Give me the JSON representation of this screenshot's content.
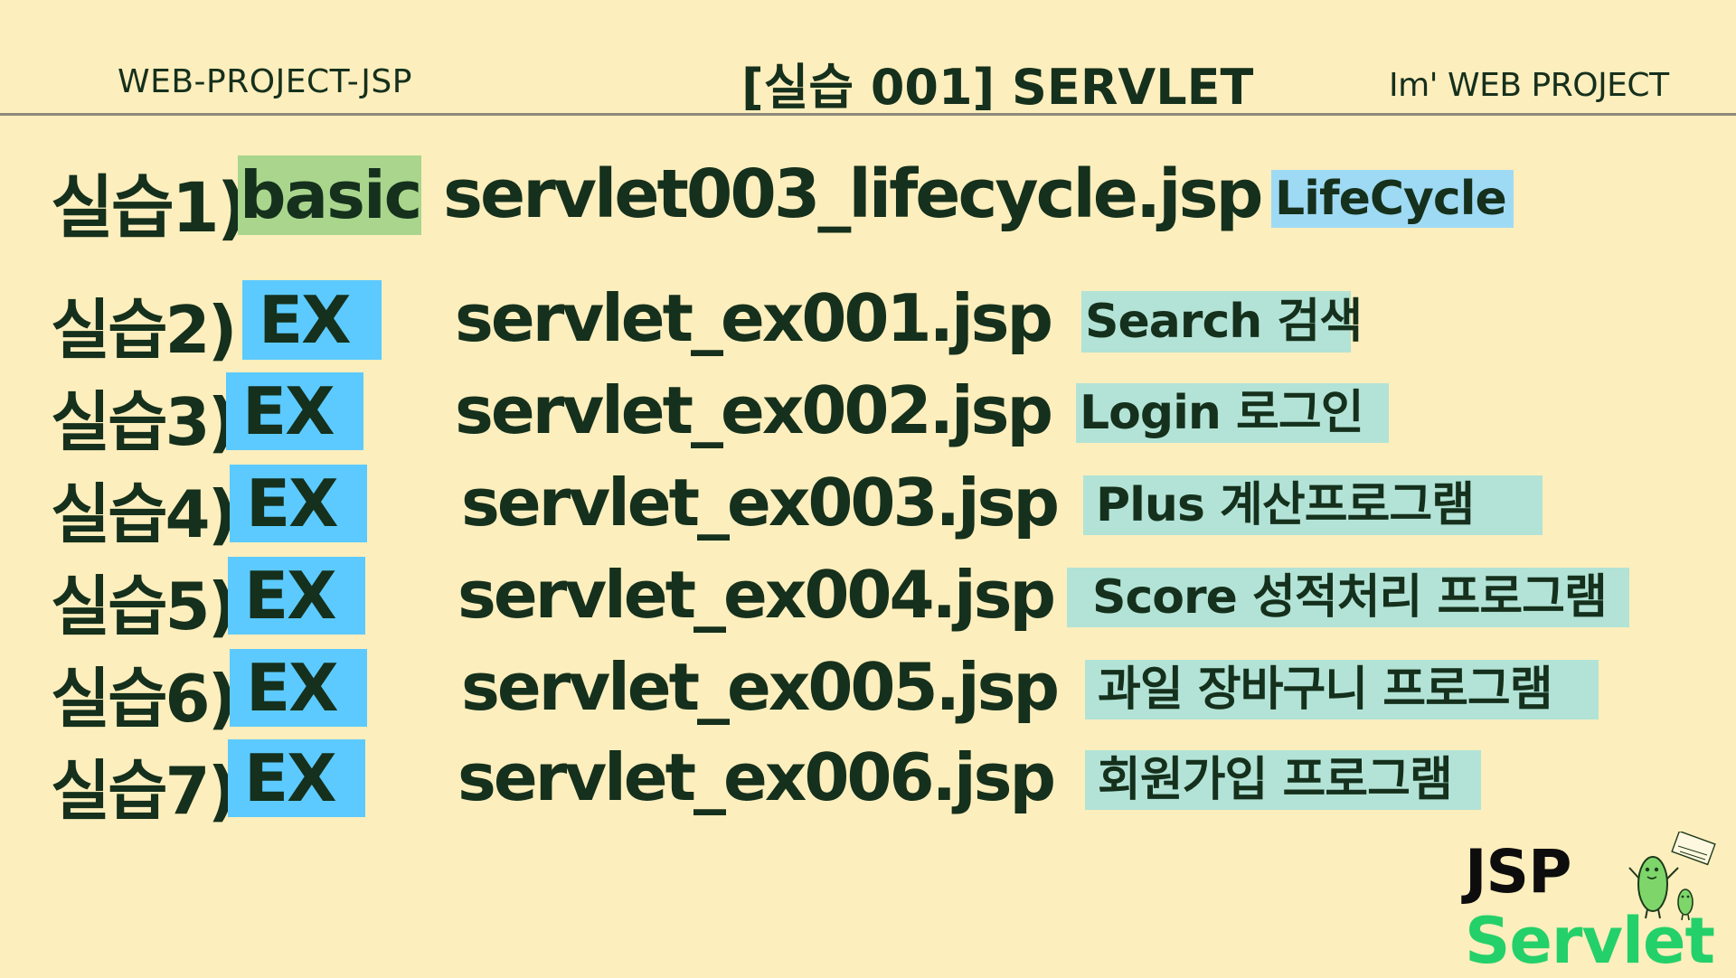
{
  "header": {
    "left": "WEB-PROJECT-JSP",
    "center": "[실습 001]  SERVLET",
    "right": "Im'  WEB PROJECT"
  },
  "rows": [
    {
      "label": "실습1)",
      "tag": "basic",
      "file": "servlet003_lifecycle.jsp",
      "desc": "LifeCycle"
    },
    {
      "label": "실습2)",
      "tag": "EX",
      "file": "servlet_ex001.jsp",
      "desc": "Search 검색"
    },
    {
      "label": "실습3)",
      "tag": "EX",
      "file": "servlet_ex002.jsp",
      "desc": "Login    로그인"
    },
    {
      "label": "실습4)",
      "tag": "EX",
      "file": "servlet_ex003.jsp",
      "desc": "Plus      계산프로그램"
    },
    {
      "label": "실습5)",
      "tag": "EX",
      "file": "servlet_ex004.jsp",
      "desc": "Score 성적처리 프로그램"
    },
    {
      "label": "실습6)",
      "tag": "EX",
      "file": "servlet_ex005.jsp",
      "desc": "과일 장바구니 프로그램"
    },
    {
      "label": "실습7)",
      "tag": "EX",
      "file": "servlet_ex006.jsp",
      "desc": "회원가입 프로그램"
    }
  ],
  "logo": {
    "line1": "JSP",
    "line2": "Servlet"
  },
  "colors": {
    "background": "#fdeebd",
    "text": "#15301c",
    "tag_ex": "#5ccaff",
    "tag_basic": "#a9d58d",
    "desc_lifecycle": "#9fdaf4",
    "desc_other": "#b2e3d6",
    "logo_servlet": "#24d06a"
  }
}
